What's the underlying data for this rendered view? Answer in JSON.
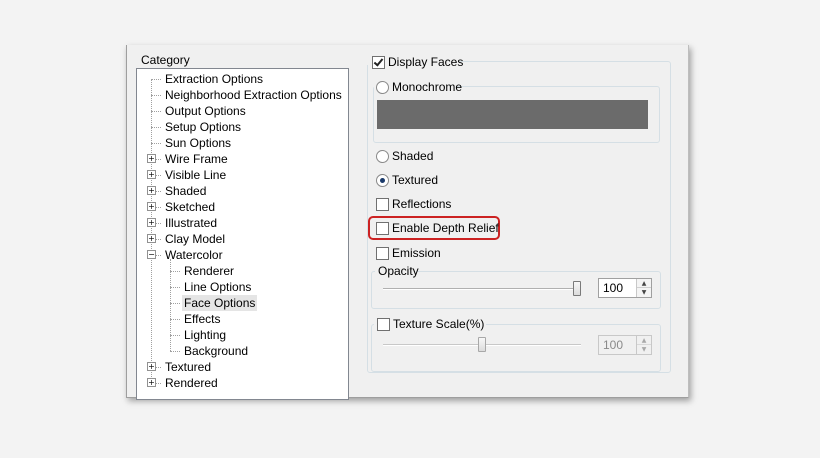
{
  "category": {
    "label": "Category",
    "items": [
      {
        "label": "Extraction Options",
        "level": 0,
        "expander": ""
      },
      {
        "label": "Neighborhood Extraction Options",
        "level": 0,
        "expander": ""
      },
      {
        "label": "Output Options",
        "level": 0,
        "expander": ""
      },
      {
        "label": "Setup Options",
        "level": 0,
        "expander": ""
      },
      {
        "label": "Sun Options",
        "level": 0,
        "expander": ""
      },
      {
        "label": "Wire Frame",
        "level": 0,
        "expander": "+"
      },
      {
        "label": "Visible Line",
        "level": 0,
        "expander": "+"
      },
      {
        "label": "Shaded",
        "level": 0,
        "expander": "+"
      },
      {
        "label": "Sketched",
        "level": 0,
        "expander": "+"
      },
      {
        "label": "Illustrated",
        "level": 0,
        "expander": "+"
      },
      {
        "label": "Clay Model",
        "level": 0,
        "expander": "+"
      },
      {
        "label": "Watercolor",
        "level": 0,
        "expander": "−"
      },
      {
        "label": "Renderer",
        "level": 1,
        "expander": ""
      },
      {
        "label": "Line Options",
        "level": 1,
        "expander": ""
      },
      {
        "label": "Face Options",
        "level": 1,
        "expander": "",
        "selected": true
      },
      {
        "label": "Effects",
        "level": 1,
        "expander": ""
      },
      {
        "label": "Lighting",
        "level": 1,
        "expander": ""
      },
      {
        "label": "Background",
        "level": 1,
        "expander": ""
      },
      {
        "label": "Textured",
        "level": 0,
        "expander": "+"
      },
      {
        "label": "Rendered",
        "level": 0,
        "expander": "+"
      }
    ]
  },
  "faces": {
    "display_faces_label": "Display Faces",
    "display_faces_checked": true,
    "monochrome_label": "Monochrome",
    "monochrome_color": "#6b6b6b",
    "shaded_label": "Shaded",
    "textured_label": "Textured",
    "selected_mode": "Textured",
    "reflections_label": "Reflections",
    "enable_depth_relief_label": "Enable Depth Relief",
    "emission_label": "Emission",
    "opacity": {
      "label": "Opacity",
      "value": "100",
      "slider_fraction": 1.0
    },
    "texture_scale": {
      "label": "Texture Scale(%)",
      "value": "100",
      "slider_fraction": 0.5
    }
  },
  "colors": {
    "highlight": "#cc2222"
  }
}
